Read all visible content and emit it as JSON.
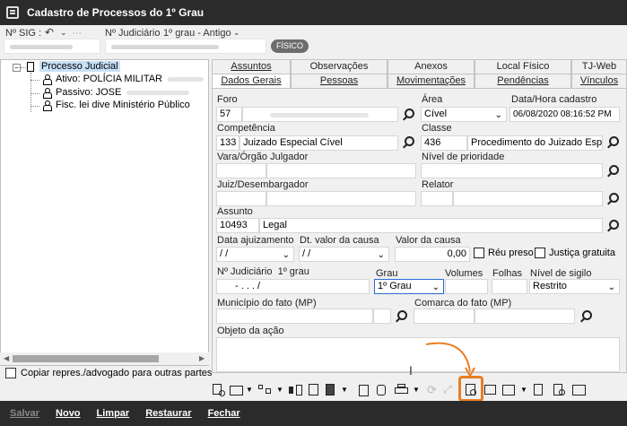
{
  "window": {
    "title": "Cadastro de Processos do 1º Grau"
  },
  "sigbar": {
    "sig_label": "Nº SIG :",
    "judiciario_label": "Nº Judiciário",
    "grau_value": "1º grau - Antigo",
    "badge": "FÍSICO"
  },
  "tree": {
    "root": "Processo Judicial",
    "items": [
      "Ativo: POLÍCIA MILITAR",
      "Passivo: JOSE",
      "Fisc. lei dive Ministério Público"
    ]
  },
  "copy_checkbox_label": "Copiar repres./advogado para outras partes",
  "tabs": {
    "row1": [
      "Assuntos",
      "Observações",
      "Anexos",
      "Local Físico",
      "TJ-Web"
    ],
    "row2": [
      "Dados Gerais",
      "Pessoas",
      "Movimentações",
      "Pendências",
      "Vínculos"
    ]
  },
  "form": {
    "foro_label": "Foro",
    "foro_value": "57",
    "area_label": "Área",
    "area_value": "Cível",
    "data_cadastro_label": "Data/Hora cadastro",
    "data_cadastro_value": "06/08/2020 08:16:52 PM",
    "competencia_label": "Competência",
    "competencia_code": "133",
    "competencia_value": "Juizado Especial Cível",
    "classe_label": "Classe",
    "classe_code": "436",
    "classe_value": "Procedimento do Juizado Espec",
    "vara_label": "Vara/Órgão Julgador",
    "prioridade_label": "Nível de prioridade",
    "juiz_label": "Juiz/Desembargador",
    "relator_label": "Relator",
    "assunto_label": "Assunto",
    "assunto_code": "10493",
    "assunto_value": "Legal",
    "data_ajuiz_label": "Data ajuizamento",
    "data_ajuiz_value": " / /",
    "dt_valor_label": "Dt. valor da causa",
    "dt_valor_value": " / /",
    "valor_label": "Valor da causa",
    "valor_value": "0,00",
    "reu_preso_label": "Réu preso",
    "justica_gratuita_label": "Justiça gratuita",
    "njud_label": "Nº Judiciário",
    "njud_grau": "1º grau",
    "njud_value": "-   .    .   .   /",
    "grau_label": "Grau",
    "grau_value": "1º Grau",
    "volumes_label": "Volumes",
    "folhas_label": "Folhas",
    "sigilo_label": "Nível de sigilo",
    "sigilo_value": "Restrito",
    "municipio_label": "Município do fato (MP)",
    "comarca_label": "Comarca do fato (MP)",
    "objeto_label": "Objeto da ação"
  },
  "bottom": {
    "salvar": "Salvar",
    "novo": "Novo",
    "limpar": "Limpar",
    "restaurar": "Restaurar",
    "fechar": "Fechar"
  },
  "colors": {
    "highlight": "#e87e22",
    "titlebar": "#2b2b2b",
    "selection": "#c7e0f7"
  }
}
